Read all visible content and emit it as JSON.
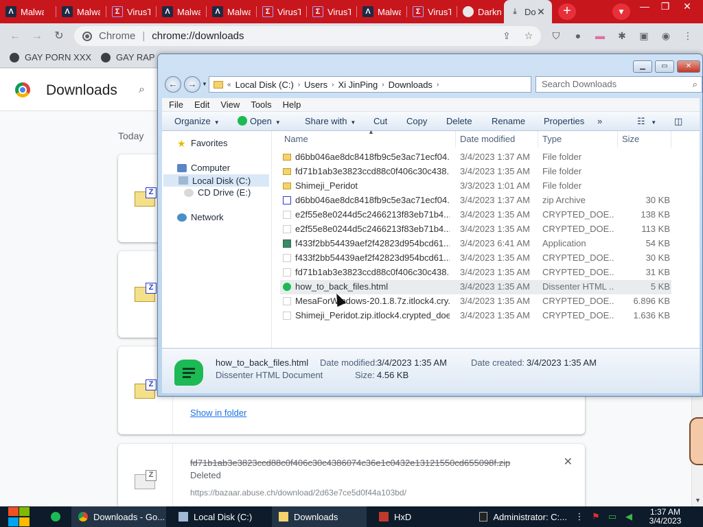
{
  "chrome": {
    "tabs": [
      {
        "label": "Malwa",
        "icon": "malware-a-icon"
      },
      {
        "label": "Malwa",
        "icon": "malware-a-icon"
      },
      {
        "label": "VirusT",
        "icon": "virustotal-icon"
      },
      {
        "label": "Malwa",
        "icon": "malware-a-icon"
      },
      {
        "label": "Malwa",
        "icon": "malware-a-icon"
      },
      {
        "label": "VirusT",
        "icon": "virustotal-icon"
      },
      {
        "label": "VirusT",
        "icon": "virustotal-icon"
      },
      {
        "label": "Malwa",
        "icon": "malware-a-icon"
      },
      {
        "label": "VirusT",
        "icon": "virustotal-icon"
      },
      {
        "label": "Darkn",
        "icon": "globe-icon"
      },
      {
        "label": "Do",
        "icon": "download-icon"
      }
    ],
    "omnibox": {
      "origin": "Chrome",
      "url": "chrome://downloads"
    },
    "bookmarks": [
      "GAY PORN XXX",
      "GAY RAP"
    ]
  },
  "downloads_page": {
    "title": "Downloads",
    "section": "Today",
    "show_in_folder": "Show in folder",
    "deleted_item": {
      "filename": "fd71b1ab3e3823ccd88c0f406c30c4386074c36e1c0432e13121550cd655098f.zip",
      "status": "Deleted",
      "url": "https://bazaar.abuse.ch/download/2d63e7ce5d0f44a103bd/"
    }
  },
  "explorer": {
    "address": [
      "Local Disk (C:)",
      "Users",
      "Xi JinPing",
      "Downloads"
    ],
    "search_placeholder": "Search Downloads",
    "menu": [
      "File",
      "Edit",
      "View",
      "Tools",
      "Help"
    ],
    "commands": {
      "organize": "Organize",
      "open": "Open",
      "share": "Share with",
      "cut": "Cut",
      "copy": "Copy",
      "delete": "Delete",
      "rename": "Rename",
      "properties": "Properties",
      "more": "»"
    },
    "nav": {
      "favorites": "Favorites",
      "computer": "Computer",
      "local_disk": "Local Disk (C:)",
      "cd_drive": "CD Drive (E:)",
      "network": "Network"
    },
    "columns": {
      "name": "Name",
      "date": "Date modified",
      "type": "Type",
      "size": "Size"
    },
    "files": [
      {
        "name": "d6bb046ae8dc8418fb9c5e3ac71ecf04...",
        "date": "3/4/2023 1:37 AM",
        "type": "File folder",
        "size": "",
        "kind": "folder"
      },
      {
        "name": "fd71b1ab3e3823ccd88c0f406c30c438...",
        "date": "3/4/2023 1:35 AM",
        "type": "File folder",
        "size": "",
        "kind": "folder"
      },
      {
        "name": "Shimeji_Peridot",
        "date": "3/3/2023 1:01 AM",
        "type": "File folder",
        "size": "",
        "kind": "folder"
      },
      {
        "name": "d6bb046ae8dc8418fb9c5e3ac71ecf04...",
        "date": "3/4/2023 1:37 AM",
        "type": "zip Archive",
        "size": "30 KB",
        "kind": "zip"
      },
      {
        "name": "e2f55e8e0244d5c2466213f83eb71b4...",
        "date": "3/4/2023 1:35 AM",
        "type": "CRYPTED_DOE...",
        "size": "138 KB",
        "kind": "file"
      },
      {
        "name": "e2f55e8e0244d5c2466213f83eb71b4...",
        "date": "3/4/2023 1:35 AM",
        "type": "CRYPTED_DOE...",
        "size": "113 KB",
        "kind": "file"
      },
      {
        "name": "f433f2bb54439aef2f42823d954bcd61...",
        "date": "3/4/2023 6:41 AM",
        "type": "Application",
        "size": "54 KB",
        "kind": "app"
      },
      {
        "name": "f433f2bb54439aef2f42823d954bcd61...",
        "date": "3/4/2023 1:35 AM",
        "type": "CRYPTED_DOE...",
        "size": "30 KB",
        "kind": "file"
      },
      {
        "name": "fd71b1ab3e3823ccd88c0f406c30c438...",
        "date": "3/4/2023 1:35 AM",
        "type": "CRYPTED_DOE...",
        "size": "31 KB",
        "kind": "file"
      },
      {
        "name": "how_to_back_files.html",
        "date": "3/4/2023 1:35 AM",
        "type": "Dissenter HTML ...",
        "size": "5 KB",
        "kind": "html"
      },
      {
        "name": "MesaForWindows-20.1.8.7z.itlock4.cry...",
        "date": "3/4/2023 1:35 AM",
        "type": "CRYPTED_DOE...",
        "size": "6.896 KB",
        "kind": "file"
      },
      {
        "name": "Shimeji_Peridot.zip.itlock4.crypted_doe...",
        "date": "3/4/2023 1:35 AM",
        "type": "CRYPTED_DOE...",
        "size": "1.636 KB",
        "kind": "file"
      }
    ],
    "details": {
      "name": "how_to_back_files.html",
      "type": "Dissenter HTML Document",
      "modified_label": "Date modified:",
      "modified": "3/4/2023 1:35 AM",
      "created_label": "Date created:",
      "created": "3/4/2023 1:35 AM",
      "size_label": "Size:",
      "size": "4.56 KB"
    }
  },
  "taskbar": {
    "items": [
      {
        "label": "Downloads - Go...",
        "icon": "chrome-icon"
      },
      {
        "label": "Local Disk (C:)",
        "icon": "drive-icon"
      },
      {
        "label": "Downloads",
        "icon": "folder-icon"
      },
      {
        "label": "HxD",
        "icon": "hxd-icon"
      },
      {
        "label": "Administrator: C:...",
        "icon": "cmd-icon"
      }
    ],
    "time": "1:37 AM",
    "date": "3/4/2023"
  },
  "colors": {
    "tab_strip": "#c8161d",
    "taskbar": "#0d1b2a",
    "link": "#1a73e8",
    "html_icon": "#1db954"
  }
}
